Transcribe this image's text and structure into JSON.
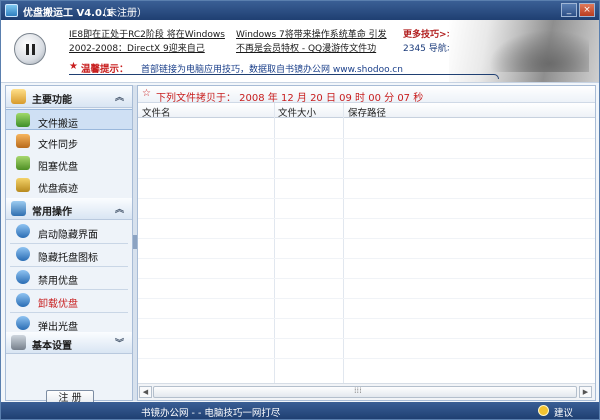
{
  "window": {
    "title": "优盘搬运工 V4.0.1",
    "reg_status": "（未注册）"
  },
  "header": {
    "news": [
      "IE8即在正处于RC2阶段 将在Windows",
      "2002-2008：DirectX 9迎来自己",
      "Windows 7将带来操作系统革命 引发",
      "不再是会员特权 - QQ漫游传文件功"
    ],
    "more_tips": "更多技巧>>",
    "nav_2345": "2345 导航>>",
    "tip_label": "温馨提示：",
    "tip_text": "首部链接为电脑应用技巧，数据取自书镜办公网 www.shodoo.cn"
  },
  "sidebar": {
    "groups": [
      {
        "label": "主要功能",
        "items": [
          "文件搬运",
          "文件同步",
          "阻塞优盘",
          "优盘痕迹"
        ]
      },
      {
        "label": "常用操作",
        "items": [
          "启动隐藏界面",
          "隐藏托盘图标",
          "禁用优盘",
          "卸载优盘",
          "弹出光盘"
        ]
      },
      {
        "label": "基本设置",
        "items": []
      }
    ],
    "register_button": "注 册"
  },
  "main": {
    "title": "下列文件拷贝于： 2008 年 12 月 20 日 09 时 00 分 07 秒",
    "columns": [
      "文件名",
      "文件大小",
      "保存路径"
    ]
  },
  "status": {
    "text": "书镜办公网 - - 电脑技巧一网打尽",
    "suggest": "建议"
  },
  "icons": {
    "title": "app-icon",
    "pause": "pause-icon",
    "tip": "star-icon",
    "group1": "folder-icon",
    "group2": "tools-icon",
    "group3": "settings-icon",
    "suggest": "lightbulb-icon"
  },
  "colors": {
    "titlebar": "#1f3f72",
    "accent_red": "#c81e1e",
    "link_blue": "#1a3f8a",
    "active_item": "#cfe0f4"
  }
}
